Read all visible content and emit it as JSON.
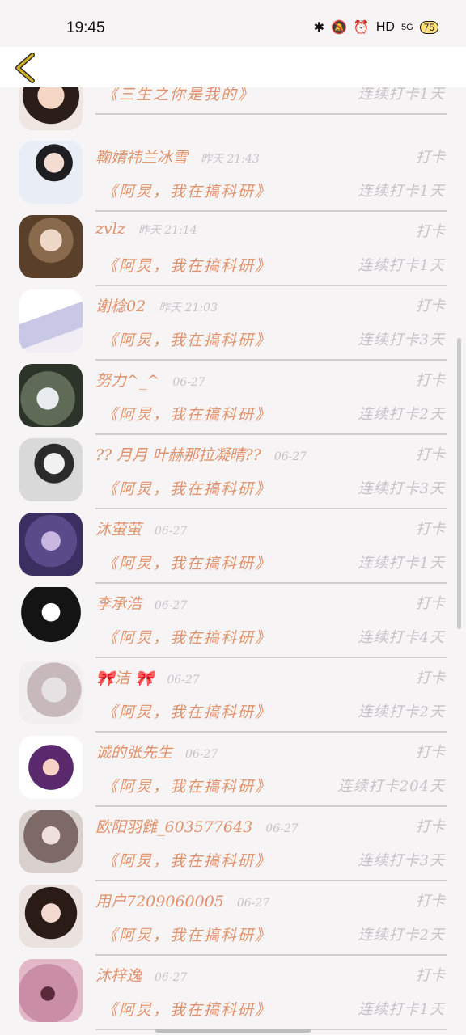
{
  "status_bar": {
    "time": "19:45",
    "network": "HD",
    "signal": "5G",
    "battery": "75",
    "icons": [
      "bluetooth-icon",
      "mute-icon",
      "alarm-icon"
    ]
  },
  "header": {
    "back_icon": "chevron-left-icon",
    "accent": "#d4b020"
  },
  "colors": {
    "name": "#e0926a",
    "muted": "#c8c2c6",
    "divider": "#cfcdd0"
  },
  "rows": [
    {
      "name": "",
      "time": "",
      "status": "",
      "club": "《三生之你是我的》",
      "streak": "连续打卡1天"
    },
    {
      "name": "鞠婧祎兰冰雪",
      "time": "昨天 21:43",
      "status": "打卡",
      "club": "《阿炅，我在搞科研》",
      "streak": "连续打卡1天"
    },
    {
      "name": "zvlz",
      "time": "昨天 21:14",
      "status": "打卡",
      "club": "《阿炅，我在搞科研》",
      "streak": "连续打卡1天"
    },
    {
      "name": "谢棯02",
      "time": "昨天 21:03",
      "status": "打卡",
      "club": "《阿炅，我在搞科研》",
      "streak": "连续打卡3天"
    },
    {
      "name": "努力^_^",
      "time": "06-27",
      "status": "打卡",
      "club": "《阿炅，我在搞科研》",
      "streak": "连续打卡2天"
    },
    {
      "name": "?? 月月 叶赫那拉凝晴??",
      "time": "06-27",
      "status": "打卡",
      "club": "《阿炅，我在搞科研》",
      "streak": "连续打卡3天"
    },
    {
      "name": "沐萤萤",
      "time": "06-27",
      "status": "打卡",
      "club": "《阿炅，我在搞科研》",
      "streak": "连续打卡1天"
    },
    {
      "name": "李承浩",
      "time": "06-27",
      "status": "打卡",
      "club": "《阿炅，我在搞科研》",
      "streak": "连续打卡4天"
    },
    {
      "name": "🎀洁 🎀",
      "time": "06-27",
      "status": "打卡",
      "club": "《阿炅，我在搞科研》",
      "streak": "连续打卡2天"
    },
    {
      "name": "诚的张先生",
      "time": "06-27",
      "status": "打卡",
      "club": "《阿炅，我在搞科研》",
      "streak": "连续打卡204天"
    },
    {
      "name": "欧阳羽雠_603577643",
      "time": "06-27",
      "status": "打卡",
      "club": "《阿炅，我在搞科研》",
      "streak": "连续打卡3天"
    },
    {
      "name": "用户7209060005",
      "time": "06-27",
      "status": "打卡",
      "club": "《阿炅，我在搞科研》",
      "streak": "连续打卡2天"
    },
    {
      "name": "沐梓逸",
      "time": "06-27",
      "status": "打卡",
      "club": "《阿炅，我在搞科研》",
      "streak": "连续打卡1天"
    }
  ]
}
